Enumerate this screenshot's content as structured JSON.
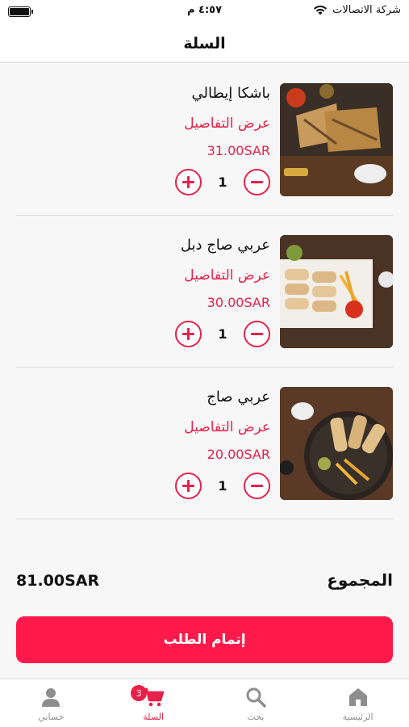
{
  "status_bar": {
    "carrier": "شركة الاتصالات",
    "time": "٤:٥٧ م"
  },
  "header": {
    "title": "السلة"
  },
  "cart": {
    "items": [
      {
        "name": "باشكا إيطالي",
        "details_link": "عرض التفاصيل",
        "price": "31.00SAR",
        "quantity": "1",
        "image": "panini-sandwich-photo"
      },
      {
        "name": "عربي صاج دبل",
        "details_link": "عرض التفاصيل",
        "price": "30.00SAR",
        "quantity": "1",
        "image": "wrap-platter-photo"
      },
      {
        "name": "عربي صاج",
        "details_link": "عرض التفاصيل",
        "price": "20.00SAR",
        "quantity": "1",
        "image": "wrap-fries-plate-photo"
      }
    ]
  },
  "summary": {
    "total_label": "المجموع",
    "total_value": "81.00SAR"
  },
  "checkout": {
    "label": "إتمام الطلب"
  },
  "tab_bar": {
    "tabs": [
      {
        "label": "حسابي",
        "icon": "person-icon"
      },
      {
        "label": "السلة",
        "icon": "cart-icon",
        "badge": "3",
        "active": true
      },
      {
        "label": "بحث",
        "icon": "search-icon"
      },
      {
        "label": "الرئيسية",
        "icon": "home-icon"
      }
    ]
  },
  "colors": {
    "accent": "#e8214a",
    "checkout_button": "#ff1a4b",
    "inactive_tab": "#8e8e8e"
  }
}
